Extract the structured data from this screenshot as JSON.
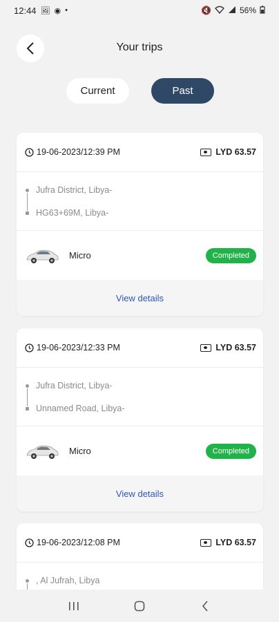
{
  "status_bar": {
    "time": "12:44",
    "battery": "56%"
  },
  "header": {
    "title": "Your trips"
  },
  "tabs": {
    "current_label": "Current",
    "past_label": "Past"
  },
  "trips": [
    {
      "datetime": "19-06-2023/12:39 PM",
      "price": "LYD 63.57",
      "pickup": "Jufra District, Libya-",
      "dropoff": "HG63+69M, Libya-",
      "vehicle": "Micro",
      "status": "Completed",
      "view_label": "View details"
    },
    {
      "datetime": "19-06-2023/12:33 PM",
      "price": "LYD 63.57",
      "pickup": "Jufra District, Libya-",
      "dropoff": "Unnamed Road, Libya-",
      "vehicle": "Micro",
      "status": "Completed",
      "view_label": "View details"
    },
    {
      "datetime": "19-06-2023/12:08 PM",
      "price": "LYD 63.57",
      "pickup": ", Al Jufrah, Libya"
    }
  ],
  "colors": {
    "accent": "#2f4866",
    "completed": "#21b24a",
    "link": "#2f55b8"
  }
}
